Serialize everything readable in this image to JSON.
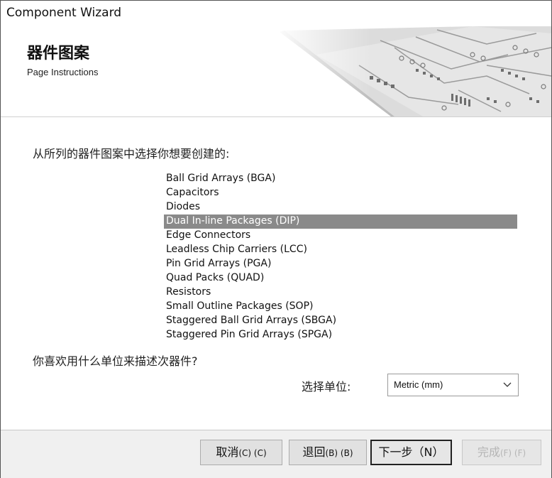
{
  "window": {
    "title": "Component Wizard"
  },
  "header": {
    "heading": "器件图案",
    "subheading": "Page Instructions"
  },
  "main": {
    "prompt_pattern": "从所列的器件图案中选择你想要创建的:",
    "patterns": [
      "Ball Grid Arrays (BGA)",
      "Capacitors",
      "Diodes",
      "Dual In-line Packages (DIP)",
      "Edge Connectors",
      "Leadless Chip Carriers (LCC)",
      "Pin Grid Arrays (PGA)",
      "Quad Packs (QUAD)",
      "Resistors",
      "Small Outline Packages (SOP)",
      "Staggered Ball Grid Arrays (SBGA)",
      "Staggered Pin Grid Arrays (SPGA)"
    ],
    "selected_pattern": "Dual In-line Packages (DIP)",
    "prompt_unit": "你喜欢用什么单位来描述次器件?",
    "unit_label": "选择单位:",
    "unit_value": "Metric (mm)"
  },
  "footer": {
    "cancel_label": "取消",
    "cancel_accel": "(C) (C)",
    "back_label": "退回",
    "back_accel": "(B) (B)",
    "next_label": "下一步（N）",
    "finish_label": "完成",
    "finish_accel": "(F) (F)"
  },
  "icons": {
    "dropdown": "chevron-down-icon",
    "banner_art": "circuit-board-image"
  },
  "colors": {
    "selection": "#8a8a8a",
    "footer_bg": "#f0f0f0"
  }
}
